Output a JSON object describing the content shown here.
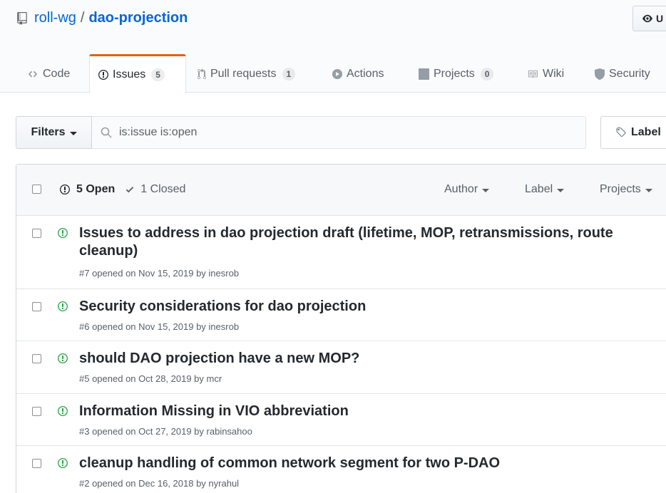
{
  "repo": {
    "owner": "roll-wg",
    "separator": "/",
    "name": "dao-projection",
    "watch_label": "U"
  },
  "tabs": [
    {
      "label": "Code",
      "icon": "code-icon"
    },
    {
      "label": "Issues",
      "icon": "issue-opened-icon",
      "counter": "5",
      "selected": true
    },
    {
      "label": "Pull requests",
      "icon": "git-pull-request-icon",
      "counter": "1"
    },
    {
      "label": "Actions",
      "icon": "play-icon"
    },
    {
      "label": "Projects",
      "icon": "project-icon",
      "counter": "0"
    },
    {
      "label": "Wiki",
      "icon": "book-icon"
    },
    {
      "label": "Security",
      "icon": "shield-icon"
    }
  ],
  "filters": {
    "button_label": "Filters",
    "search_value": "is:issue is:open",
    "labels_button": "Label"
  },
  "list_header": {
    "open_label": "5 Open",
    "closed_label": "1 Closed",
    "author_filter": "Author",
    "label_filter": "Label",
    "projects_filter": "Projects"
  },
  "issues": [
    {
      "title_line1": "Issues to address in dao projection draft (lifetime, MOP, retransmissions, route",
      "title_line2": "cleanup)",
      "meta": "#7 opened on Nov 15, 2019 by inesrob"
    },
    {
      "title_line1": "Security considerations for dao projection",
      "meta": "#6 opened on Nov 15, 2019 by inesrob"
    },
    {
      "title_line1": "should DAO projection have a new MOP?",
      "meta": "#5 opened on Oct 28, 2019 by mcr"
    },
    {
      "title_line1": "Information Missing in VIO abbreviation",
      "meta": "#3 opened on Oct 27, 2019 by rabinsahoo"
    },
    {
      "title_line1": "cleanup handling of common network segment for two P-DAO",
      "meta": "#2 opened on Dec 16, 2018 by nyrahul"
    }
  ],
  "colors": {
    "link": "#0366d6",
    "open_green": "#28a745",
    "tab_accent": "#e36209"
  }
}
